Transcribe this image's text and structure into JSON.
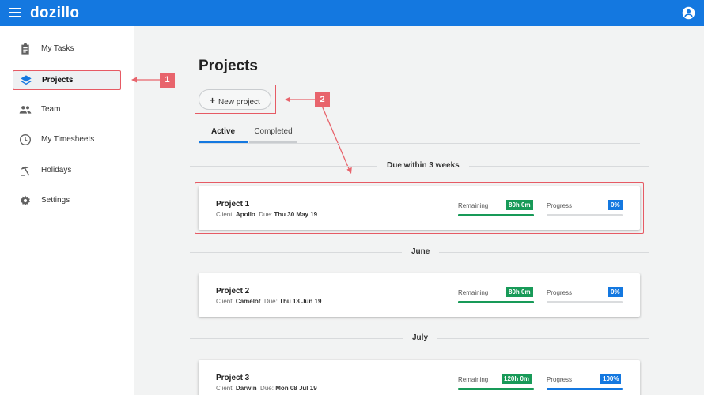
{
  "app": {
    "logo": "dozillo"
  },
  "sidebar": {
    "items": [
      {
        "label": "My Tasks",
        "icon": "clipboard-icon"
      },
      {
        "label": "Projects",
        "icon": "layers-icon",
        "active": true
      },
      {
        "label": "Team",
        "icon": "people-icon"
      },
      {
        "label": "My Timesheets",
        "icon": "clock-icon"
      },
      {
        "label": "Holidays",
        "icon": "beach-icon"
      },
      {
        "label": "Settings",
        "icon": "gear-icon"
      }
    ]
  },
  "callouts": [
    "1",
    "2"
  ],
  "main": {
    "title": "Projects",
    "new_project_label": "New project",
    "tabs": [
      {
        "label": "Active",
        "selected": true
      },
      {
        "label": "Completed",
        "selected": false
      }
    ],
    "groups": [
      {
        "label": "Due within 3 weeks",
        "projects": [
          {
            "name": "Project 1",
            "client_label": "Client:",
            "client": "Apollo",
            "due_label": "Due:",
            "due": "Thu 30 May 19",
            "remaining_label": "Remaining",
            "remaining": "80h 0m",
            "progress_label": "Progress",
            "progress": "0%",
            "progress_fraction": 0
          }
        ]
      },
      {
        "label": "June",
        "projects": [
          {
            "name": "Project 2",
            "client_label": "Client:",
            "client": "Camelot",
            "due_label": "Due:",
            "due": "Thu 13 Jun 19",
            "remaining_label": "Remaining",
            "remaining": "80h 0m",
            "progress_label": "Progress",
            "progress": "0%",
            "progress_fraction": 0
          }
        ]
      },
      {
        "label": "July",
        "projects": [
          {
            "name": "Project 3",
            "client_label": "Client:",
            "client": "Darwin",
            "due_label": "Due:",
            "due": "Mon 08 Jul 19",
            "remaining_label": "Remaining",
            "remaining": "120h 0m",
            "progress_label": "Progress",
            "progress": "100%",
            "progress_fraction": 1
          }
        ]
      }
    ]
  },
  "colors": {
    "brand": "#1478e0",
    "remaining": "#189a58",
    "progress": "#1478e0",
    "callout": "#e8646c"
  }
}
